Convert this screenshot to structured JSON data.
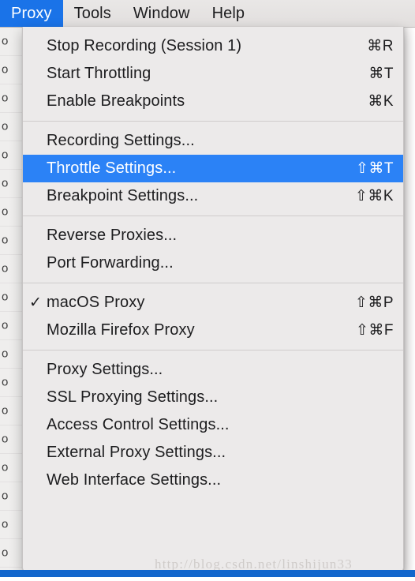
{
  "menubar": {
    "items": [
      {
        "label": "Proxy",
        "active": true
      },
      {
        "label": "Tools",
        "active": false
      },
      {
        "label": "Window",
        "active": false
      },
      {
        "label": "Help",
        "active": false
      }
    ]
  },
  "menu": {
    "title": "Proxy",
    "groups": [
      {
        "items": [
          {
            "label": "Stop Recording (Session 1)",
            "shortcut": "⌘R",
            "checked": false,
            "selected": false
          },
          {
            "label": "Start Throttling",
            "shortcut": "⌘T",
            "checked": false,
            "selected": false
          },
          {
            "label": "Enable Breakpoints",
            "shortcut": "⌘K",
            "checked": false,
            "selected": false
          }
        ]
      },
      {
        "items": [
          {
            "label": "Recording Settings...",
            "shortcut": "",
            "checked": false,
            "selected": false
          },
          {
            "label": "Throttle Settings...",
            "shortcut": "⇧⌘T",
            "checked": false,
            "selected": true
          },
          {
            "label": "Breakpoint Settings...",
            "shortcut": "⇧⌘K",
            "checked": false,
            "selected": false
          }
        ]
      },
      {
        "items": [
          {
            "label": "Reverse Proxies...",
            "shortcut": "",
            "checked": false,
            "selected": false
          },
          {
            "label": "Port Forwarding...",
            "shortcut": "",
            "checked": false,
            "selected": false
          }
        ]
      },
      {
        "items": [
          {
            "label": "macOS Proxy",
            "shortcut": "⇧⌘P",
            "checked": true,
            "selected": false
          },
          {
            "label": "Mozilla Firefox Proxy",
            "shortcut": "⇧⌘F",
            "checked": false,
            "selected": false
          }
        ]
      },
      {
        "items": [
          {
            "label": "Proxy Settings...",
            "shortcut": "",
            "checked": false,
            "selected": false
          },
          {
            "label": "SSL Proxying Settings...",
            "shortcut": "",
            "checked": false,
            "selected": false
          },
          {
            "label": "Access Control Settings...",
            "shortcut": "",
            "checked": false,
            "selected": false
          },
          {
            "label": "External Proxy Settings...",
            "shortcut": "",
            "checked": false,
            "selected": false
          },
          {
            "label": "Web Interface Settings...",
            "shortcut": "",
            "checked": false,
            "selected": false
          }
        ]
      }
    ],
    "check_glyph": "✓"
  },
  "backdrop": {
    "row_bullet": "o",
    "row_count": 19,
    "right_mark": "§"
  },
  "watermark": {
    "text": "http://blog.csdn.net/linshijun33"
  },
  "colors": {
    "menubar_active_bg": "#1a73e8",
    "menu_selected_bg": "#2b82f6",
    "menu_bg": "#eceaea",
    "bottom_bar": "#1366cc"
  }
}
